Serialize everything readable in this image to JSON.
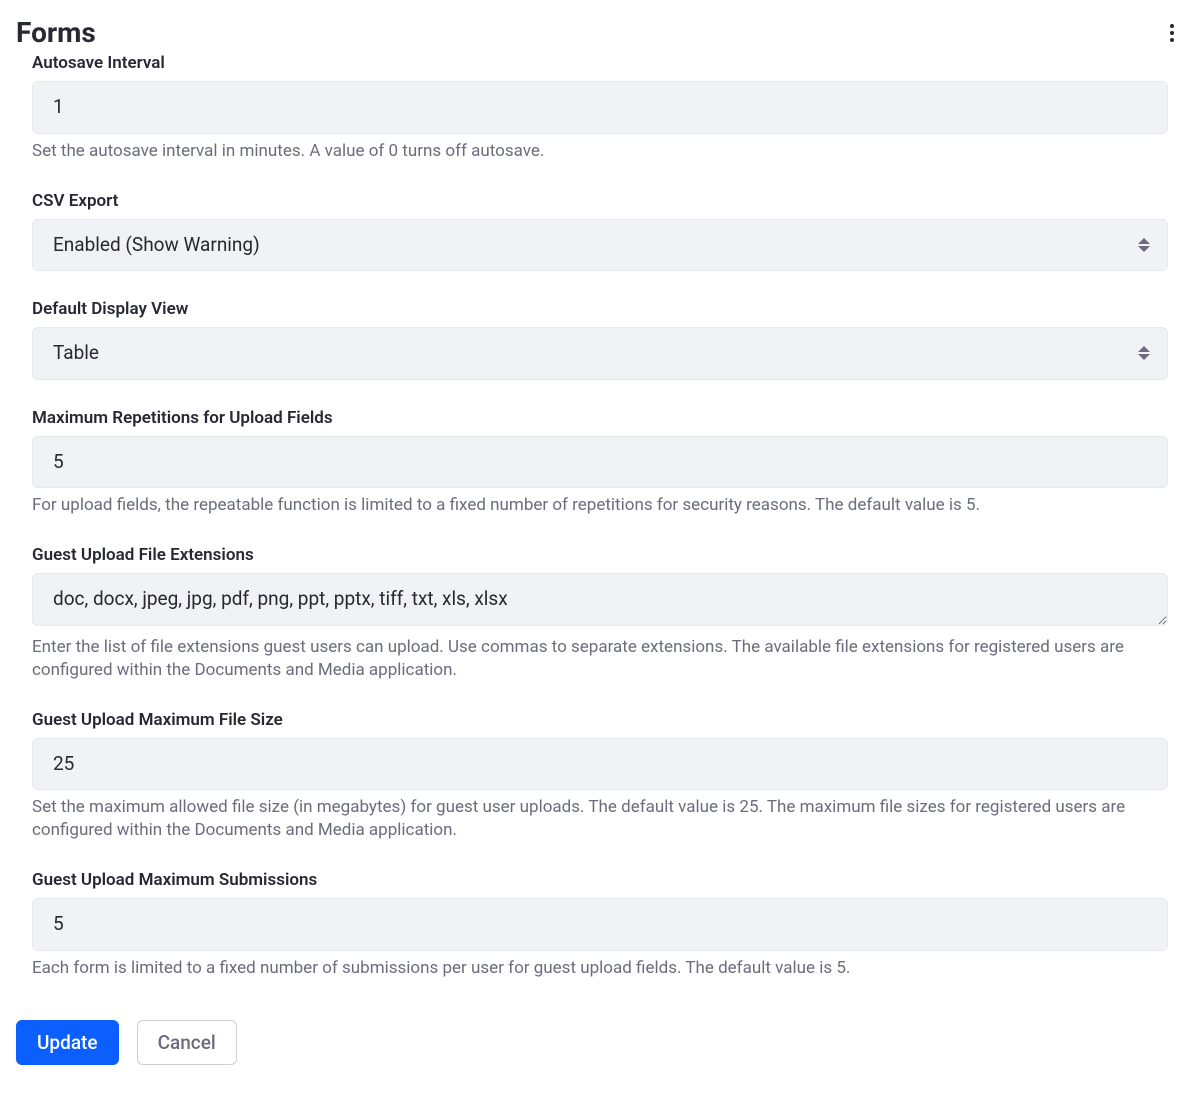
{
  "header": {
    "title": "Forms"
  },
  "fields": {
    "autosave": {
      "label": "Autosave Interval",
      "value": "1",
      "help": "Set the autosave interval in minutes. A value of 0 turns off autosave."
    },
    "csvExport": {
      "label": "CSV Export",
      "value": "Enabled (Show Warning)"
    },
    "defaultDisplayView": {
      "label": "Default Display View",
      "value": "Table"
    },
    "maxRepetitions": {
      "label": "Maximum Repetitions for Upload Fields",
      "value": "5",
      "help": "For upload fields, the repeatable function is limited to a fixed number of repetitions for security reasons. The default value is 5."
    },
    "guestExtensions": {
      "label": "Guest Upload File Extensions",
      "value": "doc, docx, jpeg, jpg, pdf, png, ppt, pptx, tiff, txt, xls, xlsx",
      "help": "Enter the list of file extensions guest users can upload. Use commas to separate extensions. The available file extensions for registered users are configured within the Documents and Media application."
    },
    "guestMaxFileSize": {
      "label": "Guest Upload Maximum File Size",
      "value": "25",
      "help": "Set the maximum allowed file size (in megabytes) for guest user uploads. The default value is 25. The maximum file sizes for registered users are configured within the Documents and Media application."
    },
    "guestMaxSubmissions": {
      "label": "Guest Upload Maximum Submissions",
      "value": "5",
      "help": "Each form is limited to a fixed number of submissions per user for guest upload fields. The default value is 5."
    }
  },
  "buttons": {
    "update": "Update",
    "cancel": "Cancel"
  }
}
